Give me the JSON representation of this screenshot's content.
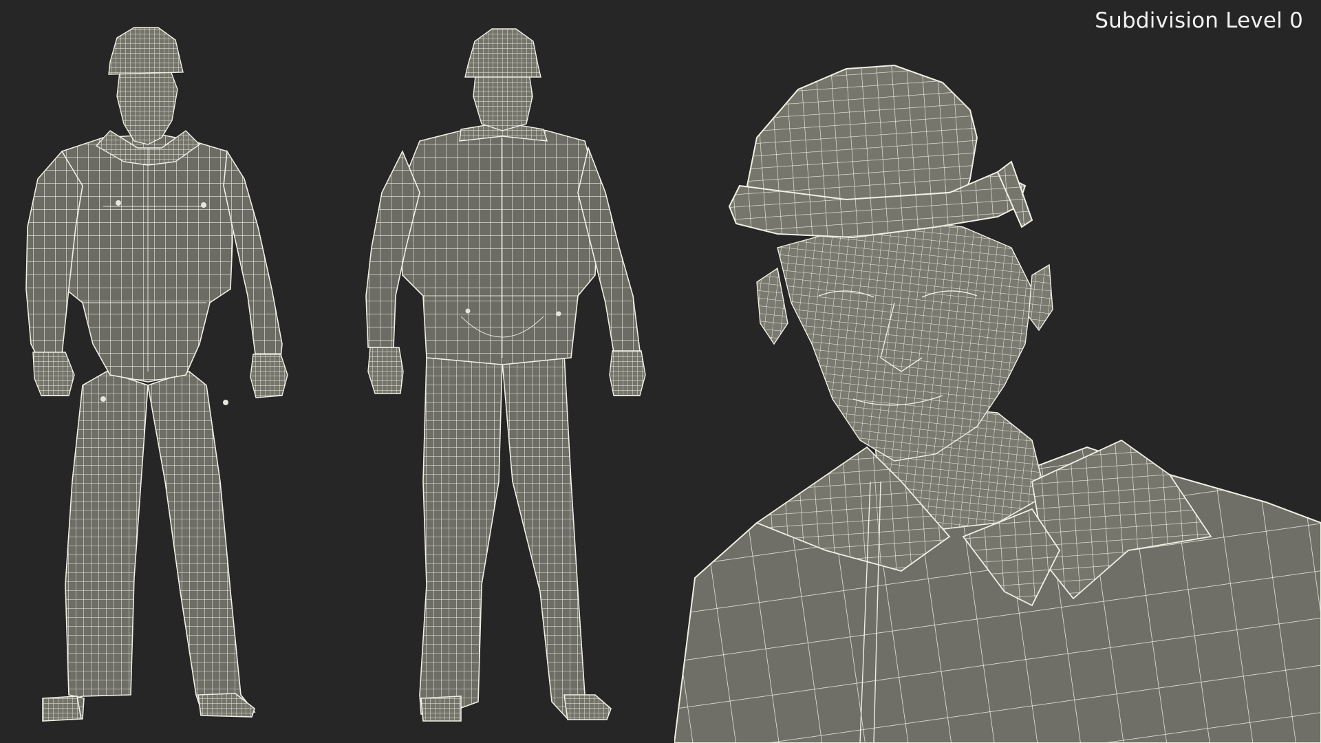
{
  "render": {
    "caption": "Subdivision Level 0",
    "background_color": "#262626",
    "mesh_fill_color": "#6e6e66",
    "wire_color": "#f0efe4"
  },
  "views": [
    {
      "id": "front",
      "icon": "worker-front-wireframe-icon"
    },
    {
      "id": "back",
      "icon": "worker-back-wireframe-icon"
    },
    {
      "id": "closeup",
      "icon": "worker-head-closeup-wireframe-icon"
    }
  ]
}
